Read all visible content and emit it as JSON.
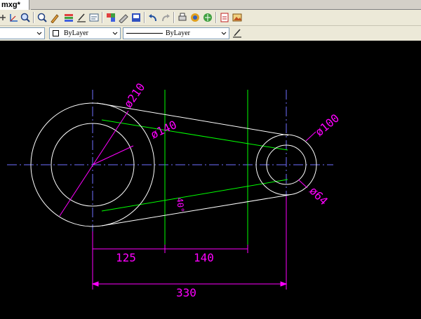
{
  "document_tab": {
    "title": "mxg*"
  },
  "toolbar": {
    "icons": [
      "pan-icon",
      "ucs-icon",
      "zoom-icon",
      "zoom-realtime-icon",
      "match-properties-icon",
      "layer-icon",
      "block-icon",
      "properties-icon",
      "design-center-icon",
      "tool-palette-icon",
      "sheet-set-icon",
      "undo-icon",
      "redo-icon",
      "print-icon",
      "render-icon",
      "publish-icon",
      "pdf-icon",
      "image-icon"
    ]
  },
  "properties_bar": {
    "layer_value": "",
    "color_value": "ByLayer",
    "linetype_value": "ByLayer"
  },
  "drawing": {
    "dims": {
      "d210": "ø210",
      "d140": "ø140",
      "d100": "ø100",
      "d64": "ø64",
      "len125": "125",
      "len140": "140",
      "len330": "330",
      "angle": "40°"
    },
    "colors": {
      "background": "#000000",
      "object": "#ffffff",
      "center": "#6f6fff",
      "construction": "#00ff00",
      "dimension": "#ff00ff"
    }
  }
}
